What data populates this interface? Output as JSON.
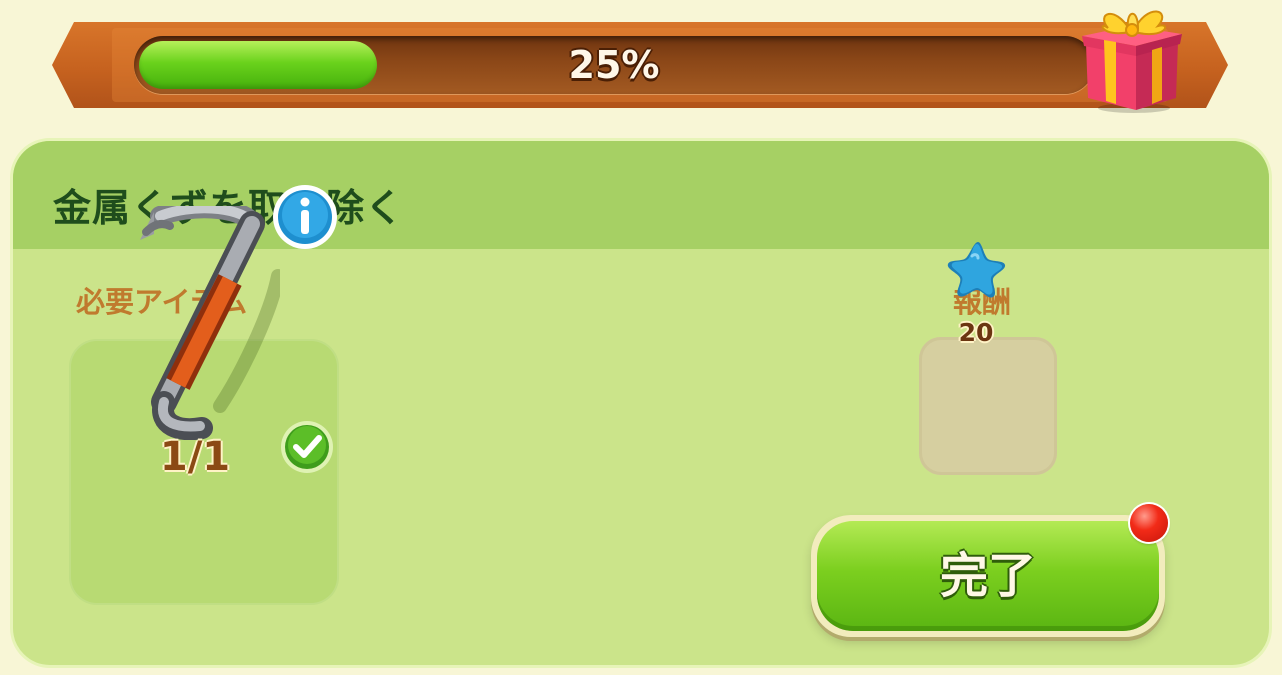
{
  "progress": {
    "percent_label": "25%",
    "value_fraction": 0.25,
    "fill_color": "#5bc416",
    "reward_icon": "gift-box-icon"
  },
  "quest": {
    "title": "金属くずを取り除く",
    "required_label": "必要アイテム",
    "reward_label": "報酬",
    "required_item": {
      "icon": "crowbar-icon",
      "count_label": "1/1",
      "completed": true
    },
    "reward": {
      "icon": "blue-star-icon",
      "amount": "20"
    },
    "complete_button_label": "完了",
    "has_notification": true
  },
  "colors": {
    "title_text": "#1f4d1c",
    "section_label": "#c07a2e",
    "panel_bg": "#cbe48a",
    "panel_header_bg": "#a6d064",
    "button_green": "#7ccf1f",
    "banner_orange": "#c6621f",
    "star_blue": "#2aa2e0",
    "notification_red": "#f22b18"
  }
}
